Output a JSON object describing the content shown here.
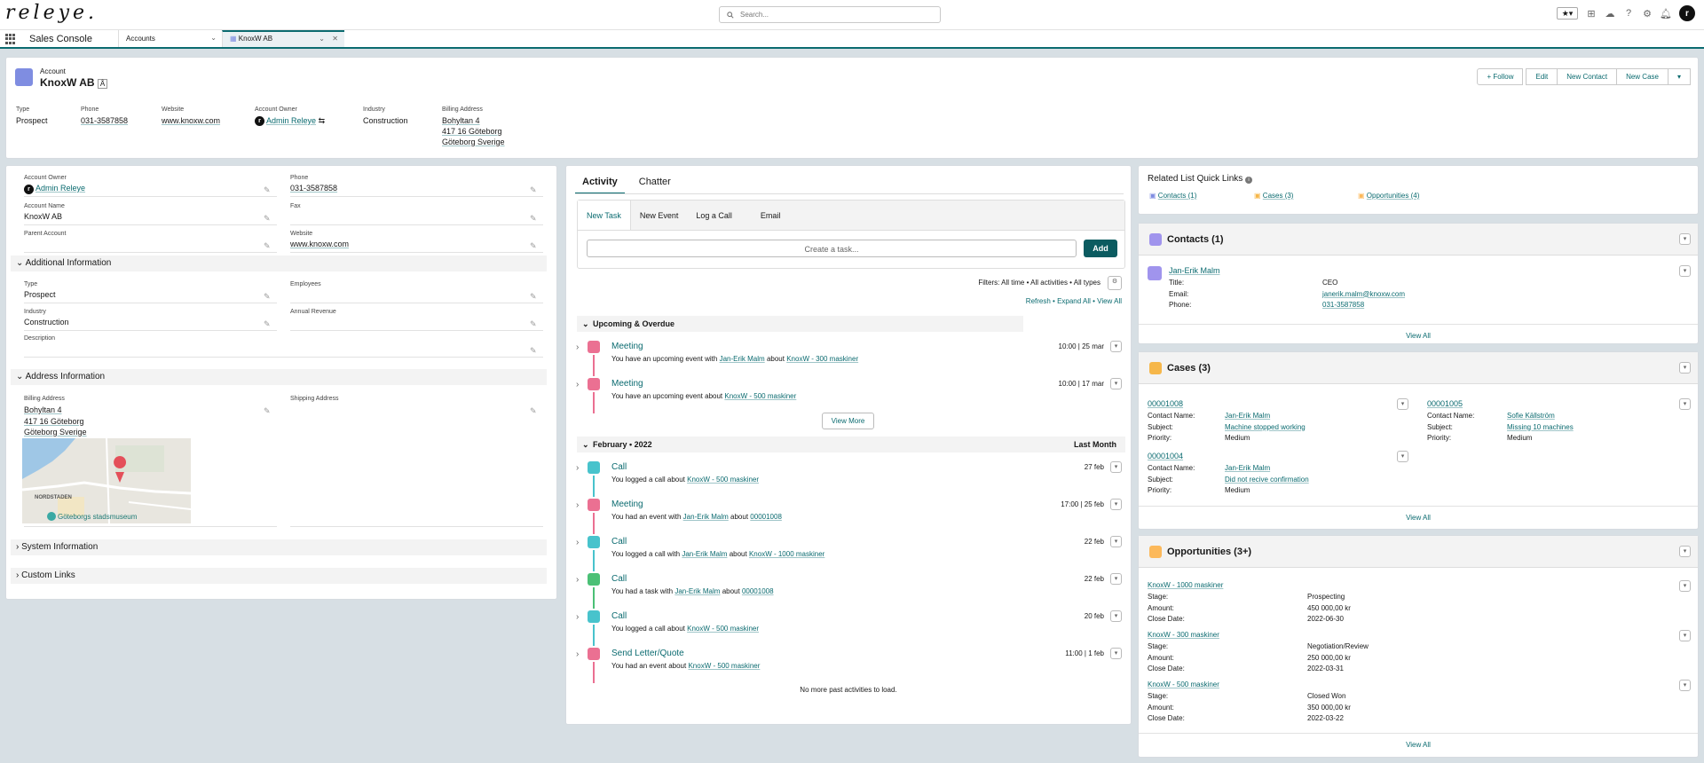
{
  "header": {
    "logo": "releye.",
    "search_placeholder": "Search...",
    "avatar_initial": "r"
  },
  "tabs": {
    "app_name": "Sales Console",
    "tab1": "Accounts",
    "tab2": "KnoxW AB"
  },
  "highlights": {
    "object_label": "Account",
    "name": "KnoxW AB",
    "buttons": [
      "Follow",
      "Edit",
      "New Contact",
      "New Case"
    ],
    "fields": [
      {
        "label": "Type",
        "value": "Prospect"
      },
      {
        "label": "Phone",
        "value": "031-3587858"
      },
      {
        "label": "Website",
        "value": "www.knoxw.com"
      },
      {
        "label": "Account Owner",
        "value": "Admin Releye"
      },
      {
        "label": "Industry",
        "value": "Construction"
      },
      {
        "label": "Billing Address",
        "line1": "Bohyltan 4",
        "line2": "417 16 Göteborg",
        "line3": "Göteborg Sverige"
      }
    ]
  },
  "details": {
    "account_owner_label": "Account Owner",
    "account_owner": "Admin Releye",
    "phone_label": "Phone",
    "phone": "031-3587858",
    "account_name_label": "Account Name",
    "account_name": "KnoxW AB",
    "fax_label": "Fax",
    "parent_label": "Parent Account",
    "website_label": "Website",
    "website": "www.knoxw.com",
    "sec_additional": "Additional Information",
    "type_label": "Type",
    "type": "Prospect",
    "employees_label": "Employees",
    "industry_label": "Industry",
    "industry": "Construction",
    "revenue_label": "Annual Revenue",
    "description_label": "Description",
    "sec_address": "Address Information",
    "billing_label": "Billing Address",
    "billing1": "Bohyltan 4",
    "billing2": "417 16 Göteborg",
    "billing3": "Göteborg Sverige",
    "shipping_label": "Shipping Address",
    "map_label1": "NORDSTADEN",
    "map_label2": "Göteborgs stadsmuseum",
    "sec_system": "System Information",
    "sec_custom": "Custom Links"
  },
  "activity": {
    "tab_activity": "Activity",
    "tab_chatter": "Chatter",
    "task_tabs": [
      "New Task",
      "New Event",
      "Log a Call",
      "Email"
    ],
    "task_placeholder": "Create a task...",
    "add": "Add",
    "filters": "Filters: All time • All activities • All types",
    "refresh": "Refresh",
    "expand_all": "Expand All",
    "view_all": "View All",
    "upcoming": "Upcoming & Overdue",
    "view_more": "View More",
    "feb": "February • 2022",
    "last_month": "Last Month",
    "items": [
      {
        "title": "Meeting",
        "pre": "You have an upcoming event with",
        "who": "Jan-Erik Malm",
        "mid": "about",
        "what": "KnoxW - 300 maskiner",
        "date": "10:00 | 25 mar",
        "color": "#eb7092"
      },
      {
        "title": "Meeting",
        "pre": "You have an upcoming event about",
        "who": "",
        "mid": "",
        "what": "KnoxW - 500 maskiner",
        "date": "10:00 | 17 mar",
        "color": "#eb7092"
      },
      {
        "title": "Call",
        "pre": "You logged a call about",
        "who": "",
        "mid": "",
        "what": "KnoxW - 500 maskiner",
        "date": "27 feb",
        "color": "#48c3cc"
      },
      {
        "title": "Meeting",
        "pre": "You had an event with",
        "who": "Jan-Erik Malm",
        "mid": "about",
        "what": "00001008",
        "date": "17:00 | 25 feb",
        "color": "#eb7092"
      },
      {
        "title": "Call",
        "pre": "You logged a call with",
        "who": "Jan-Erik Malm",
        "mid": "about",
        "what": "KnoxW - 1000 maskiner",
        "date": "22 feb",
        "color": "#48c3cc"
      },
      {
        "title": "Call",
        "pre": "You had a task with",
        "who": "Jan-Erik Malm",
        "mid": "about",
        "what": "00001008",
        "date": "22 feb",
        "color": "#4bc076"
      },
      {
        "title": "Call",
        "pre": "You logged a call about",
        "who": "",
        "mid": "",
        "what": "KnoxW - 500 maskiner",
        "date": "20 feb",
        "color": "#48c3cc"
      },
      {
        "title": "Send Letter/Quote",
        "pre": "You had an event about",
        "who": "",
        "mid": "",
        "what": "KnoxW - 500 maskiner",
        "date": "11:00 | 1 feb",
        "color": "#eb7092"
      }
    ],
    "no_more": "No more past activities to load."
  },
  "related": {
    "quick_title": "Related List Quick Links",
    "quick_links": [
      "Contacts (1)",
      "Cases (3)",
      "Opportunities (4)"
    ],
    "contacts_title": "Contacts (1)",
    "contact_name": "Jan-Erik Malm",
    "contact_title_lbl": "Title:",
    "contact_title": "CEO",
    "contact_email_lbl": "Email:",
    "contact_email": "janerik.malm@knoxw.com",
    "contact_phone_lbl": "Phone:",
    "contact_phone": "031-3587858",
    "view_all": "View All",
    "cases_title": "Cases (3)",
    "cases": [
      {
        "num": "00001008",
        "contact": "Jan-Erik Malm",
        "subject": "Machine stopped working",
        "priority": "Medium"
      },
      {
        "num": "00001005",
        "contact": "Sofie Källström",
        "subject": "Missing 10 machines",
        "priority": "Medium"
      },
      {
        "num": "00001004",
        "contact": "Jan-Erik Malm",
        "subject": "Did not recive confirmation",
        "priority": "Medium"
      }
    ],
    "lbl_contact": "Contact Name:",
    "lbl_subject": "Subject:",
    "lbl_priority": "Priority:",
    "opps_title": "Opportunities (3+)",
    "opps": [
      {
        "name": "KnoxW - 1000 maskiner",
        "stage": "Prospecting",
        "amount": "450 000,00 kr",
        "close": "2022-06-30"
      },
      {
        "name": "KnoxW - 300 maskiner",
        "stage": "Negotiation/Review",
        "amount": "250 000,00 kr",
        "close": "2022-03-31"
      },
      {
        "name": "KnoxW - 500 maskiner",
        "stage": "Closed Won",
        "amount": "350 000,00 kr",
        "close": "2022-03-22"
      }
    ],
    "lbl_stage": "Stage:",
    "lbl_amount": "Amount:",
    "lbl_close": "Close Date:"
  }
}
